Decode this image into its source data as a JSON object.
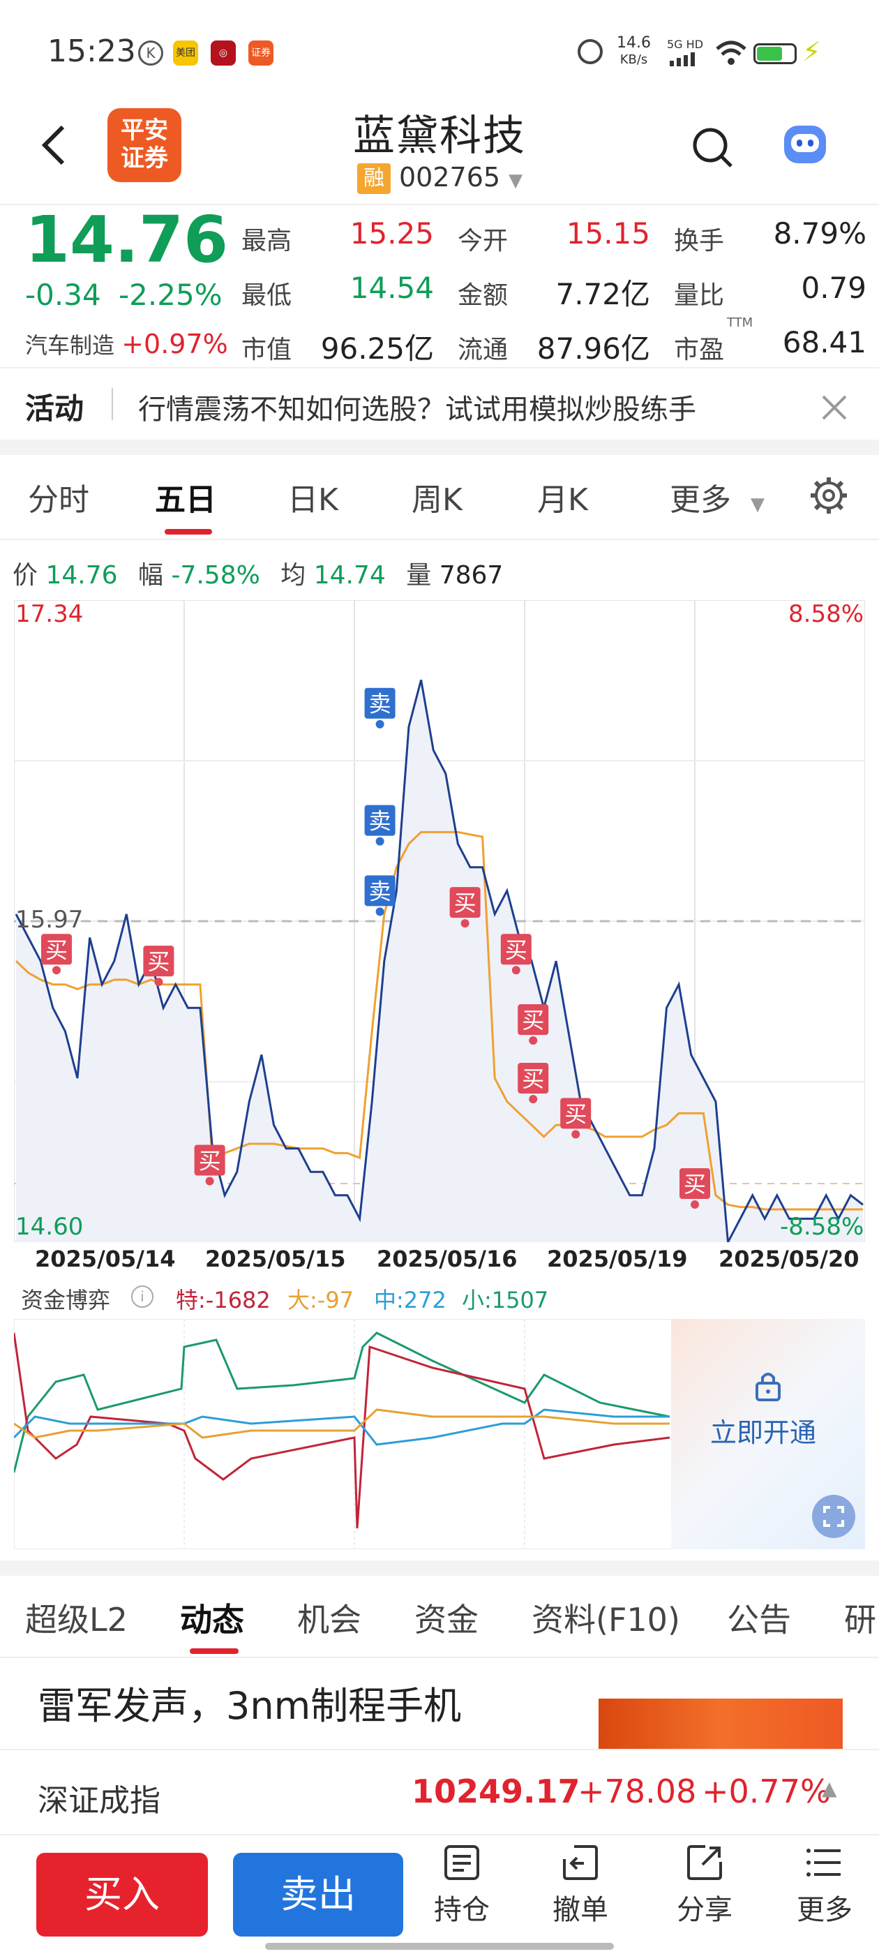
{
  "status_bar": {
    "time": "15:23",
    "net_speed_value": "14.6",
    "net_speed_unit": "KB/s",
    "network": "5G HD"
  },
  "header": {
    "logo_text_line1": "平安",
    "logo_text_line2": "证券",
    "title": "蓝黛科技",
    "badge": "融",
    "code": "002765"
  },
  "quote": {
    "price": "14.76",
    "change": "-0.34",
    "change_pct": "-2.25%",
    "sector_name": "汽车制造",
    "sector_change": "+0.97%",
    "rows": [
      {
        "label": "最高",
        "value": "15.25",
        "label2": "今开",
        "value2": "15.15",
        "label3": "换手",
        "value3": "8.79%"
      },
      {
        "label": "最低",
        "value": "14.54",
        "label2": "金额",
        "value2": "7.72亿",
        "label3": "量比",
        "value3": "0.79"
      },
      {
        "label": "市值",
        "value": "96.25亿",
        "label2": "流通",
        "value2": "87.96亿",
        "label3": "市盈",
        "value3": "68.41"
      }
    ],
    "pe_sup": "TTM"
  },
  "activity": {
    "label": "活动",
    "text": "行情震荡不知如何选股？试试用模拟炒股练手"
  },
  "chart_tabs": [
    "分时",
    "五日",
    "日K",
    "周K",
    "月K",
    "更多"
  ],
  "chart_info": {
    "price_label": "价",
    "price": "14.76",
    "range_label": "幅",
    "range": "-7.58%",
    "avg_label": "均",
    "avg": "14.74",
    "vol_label": "量",
    "vol": "7867"
  },
  "chart_data": {
    "type": "line",
    "y_high": "17.34",
    "y_low": "14.60",
    "y_ref": "15.97",
    "pct_high": "8.58%",
    "pct_low": "-8.58%",
    "dates": [
      "2025/05/14",
      "2025/05/15",
      "2025/05/16",
      "2025/05/19",
      "2025/05/20"
    ],
    "ylim": [
      14.6,
      17.34
    ],
    "series": [
      {
        "values": [
          16.0,
          15.9,
          15.8,
          15.6,
          15.5,
          15.3,
          15.9,
          15.7,
          15.8,
          16.0,
          15.7,
          15.8,
          15.6,
          15.7,
          15.6,
          15.6,
          15.0,
          14.8,
          14.9,
          15.2,
          15.4,
          15.1,
          15.0,
          15.0,
          14.9,
          14.9,
          14.8,
          14.8,
          14.7,
          15.2,
          15.8,
          16.1,
          16.8,
          17.0,
          16.7,
          16.6,
          16.3,
          16.2,
          16.2,
          16.0,
          16.1,
          15.9,
          15.8,
          15.6,
          15.8,
          15.5,
          15.2,
          15.1,
          15.0,
          14.9,
          14.8,
          14.8,
          15.0,
          15.6,
          15.7,
          15.4,
          15.3,
          15.2,
          14.6,
          14.7,
          14.8,
          14.7,
          14.8,
          14.7,
          14.7,
          14.7,
          14.8,
          14.7,
          14.8,
          14.76
        ]
      },
      {
        "values": [
          15.8,
          15.75,
          15.72,
          15.7,
          15.7,
          15.68,
          15.7,
          15.7,
          15.72,
          15.72,
          15.7,
          15.72,
          15.7,
          15.7,
          15.7,
          15.7,
          14.95,
          14.98,
          15.0,
          15.02,
          15.02,
          15.02,
          15.01,
          15.0,
          15.0,
          15.0,
          14.98,
          14.98,
          14.96,
          15.5,
          16.0,
          16.2,
          16.3,
          16.35,
          16.35,
          16.35,
          16.35,
          16.34,
          16.33,
          15.3,
          15.2,
          15.15,
          15.1,
          15.05,
          15.1,
          15.1,
          15.1,
          15.08,
          15.05,
          15.05,
          15.05,
          15.05,
          15.08,
          15.1,
          15.15,
          15.15,
          15.15,
          14.8,
          14.76,
          14.75,
          14.75,
          14.74,
          14.74,
          14.74,
          14.74,
          14.74,
          14.74,
          14.74,
          14.74,
          14.74
        ]
      }
    ],
    "markers": [
      {
        "label": "买",
        "x": 0.05,
        "y": 15.85
      },
      {
        "label": "买",
        "x": 0.17,
        "y": 15.8
      },
      {
        "label": "买",
        "x": 0.23,
        "y": 14.95
      },
      {
        "label": "卖",
        "x": 0.43,
        "y": 16.9
      },
      {
        "label": "卖",
        "x": 0.43,
        "y": 16.4
      },
      {
        "label": "卖",
        "x": 0.43,
        "y": 16.1
      },
      {
        "label": "买",
        "x": 0.53,
        "y": 16.05
      },
      {
        "label": "买",
        "x": 0.59,
        "y": 15.85
      },
      {
        "label": "买",
        "x": 0.61,
        "y": 15.55
      },
      {
        "label": "买",
        "x": 0.61,
        "y": 15.3
      },
      {
        "label": "买",
        "x": 0.66,
        "y": 15.15
      },
      {
        "label": "买",
        "x": 0.8,
        "y": 14.85
      }
    ]
  },
  "fund_flow": {
    "title": "资金博弈",
    "te": "特:-1682",
    "da": "大:-97",
    "zhong": "中:272",
    "xiao": "小:1507",
    "unlock": "立即开通",
    "colors": {
      "te": "#c0243a",
      "da": "#e8a033",
      "zhong": "#2b9ed8",
      "xiao": "#1a9a6a"
    }
  },
  "bottom_tabs": [
    "超级L2",
    "动态",
    "机会",
    "资金",
    "资料(F10)",
    "公告",
    "研"
  ],
  "news_headline": "雷军发声，3nm制程手机",
  "index_ticker": {
    "name": "深证成指",
    "value": "10249.17",
    "change": "+78.08",
    "pct": "+0.77%"
  },
  "actions": {
    "buy": "买入",
    "sell": "卖出",
    "tools": [
      "持仓",
      "撤单",
      "分享",
      "更多"
    ]
  }
}
